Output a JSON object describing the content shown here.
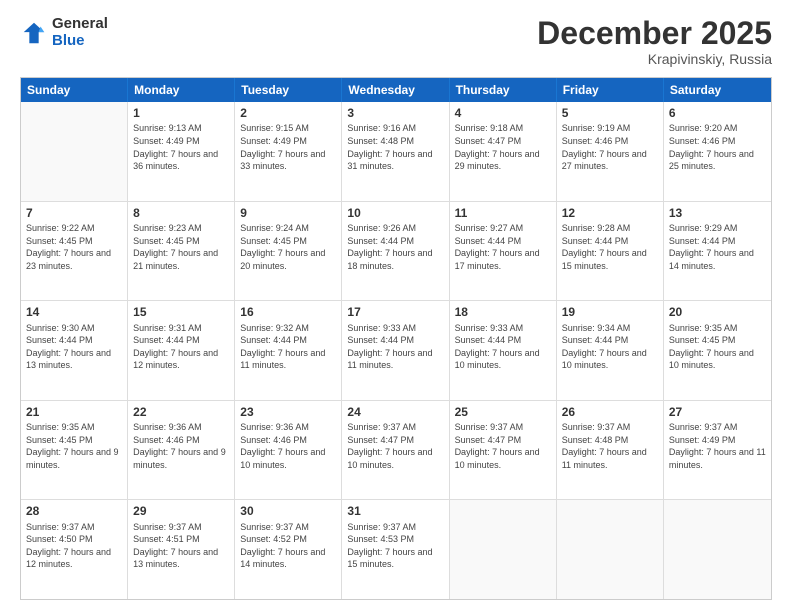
{
  "header": {
    "logo_general": "General",
    "logo_blue": "Blue",
    "month_title": "December 2025",
    "subtitle": "Krapivinskiy, Russia"
  },
  "calendar": {
    "days_of_week": [
      "Sunday",
      "Monday",
      "Tuesday",
      "Wednesday",
      "Thursday",
      "Friday",
      "Saturday"
    ],
    "rows": [
      [
        {
          "day": "",
          "info": ""
        },
        {
          "day": "1",
          "info": "Sunrise: 9:13 AM\nSunset: 4:49 PM\nDaylight: 7 hours\nand 36 minutes."
        },
        {
          "day": "2",
          "info": "Sunrise: 9:15 AM\nSunset: 4:49 PM\nDaylight: 7 hours\nand 33 minutes."
        },
        {
          "day": "3",
          "info": "Sunrise: 9:16 AM\nSunset: 4:48 PM\nDaylight: 7 hours\nand 31 minutes."
        },
        {
          "day": "4",
          "info": "Sunrise: 9:18 AM\nSunset: 4:47 PM\nDaylight: 7 hours\nand 29 minutes."
        },
        {
          "day": "5",
          "info": "Sunrise: 9:19 AM\nSunset: 4:46 PM\nDaylight: 7 hours\nand 27 minutes."
        },
        {
          "day": "6",
          "info": "Sunrise: 9:20 AM\nSunset: 4:46 PM\nDaylight: 7 hours\nand 25 minutes."
        }
      ],
      [
        {
          "day": "7",
          "info": "Sunrise: 9:22 AM\nSunset: 4:45 PM\nDaylight: 7 hours\nand 23 minutes."
        },
        {
          "day": "8",
          "info": "Sunrise: 9:23 AM\nSunset: 4:45 PM\nDaylight: 7 hours\nand 21 minutes."
        },
        {
          "day": "9",
          "info": "Sunrise: 9:24 AM\nSunset: 4:45 PM\nDaylight: 7 hours\nand 20 minutes."
        },
        {
          "day": "10",
          "info": "Sunrise: 9:26 AM\nSunset: 4:44 PM\nDaylight: 7 hours\nand 18 minutes."
        },
        {
          "day": "11",
          "info": "Sunrise: 9:27 AM\nSunset: 4:44 PM\nDaylight: 7 hours\nand 17 minutes."
        },
        {
          "day": "12",
          "info": "Sunrise: 9:28 AM\nSunset: 4:44 PM\nDaylight: 7 hours\nand 15 minutes."
        },
        {
          "day": "13",
          "info": "Sunrise: 9:29 AM\nSunset: 4:44 PM\nDaylight: 7 hours\nand 14 minutes."
        }
      ],
      [
        {
          "day": "14",
          "info": "Sunrise: 9:30 AM\nSunset: 4:44 PM\nDaylight: 7 hours\nand 13 minutes."
        },
        {
          "day": "15",
          "info": "Sunrise: 9:31 AM\nSunset: 4:44 PM\nDaylight: 7 hours\nand 12 minutes."
        },
        {
          "day": "16",
          "info": "Sunrise: 9:32 AM\nSunset: 4:44 PM\nDaylight: 7 hours\nand 11 minutes."
        },
        {
          "day": "17",
          "info": "Sunrise: 9:33 AM\nSunset: 4:44 PM\nDaylight: 7 hours\nand 11 minutes."
        },
        {
          "day": "18",
          "info": "Sunrise: 9:33 AM\nSunset: 4:44 PM\nDaylight: 7 hours\nand 10 minutes."
        },
        {
          "day": "19",
          "info": "Sunrise: 9:34 AM\nSunset: 4:44 PM\nDaylight: 7 hours\nand 10 minutes."
        },
        {
          "day": "20",
          "info": "Sunrise: 9:35 AM\nSunset: 4:45 PM\nDaylight: 7 hours\nand 10 minutes."
        }
      ],
      [
        {
          "day": "21",
          "info": "Sunrise: 9:35 AM\nSunset: 4:45 PM\nDaylight: 7 hours\nand 9 minutes."
        },
        {
          "day": "22",
          "info": "Sunrise: 9:36 AM\nSunset: 4:46 PM\nDaylight: 7 hours\nand 9 minutes."
        },
        {
          "day": "23",
          "info": "Sunrise: 9:36 AM\nSunset: 4:46 PM\nDaylight: 7 hours\nand 10 minutes."
        },
        {
          "day": "24",
          "info": "Sunrise: 9:37 AM\nSunset: 4:47 PM\nDaylight: 7 hours\nand 10 minutes."
        },
        {
          "day": "25",
          "info": "Sunrise: 9:37 AM\nSunset: 4:47 PM\nDaylight: 7 hours\nand 10 minutes."
        },
        {
          "day": "26",
          "info": "Sunrise: 9:37 AM\nSunset: 4:48 PM\nDaylight: 7 hours\nand 11 minutes."
        },
        {
          "day": "27",
          "info": "Sunrise: 9:37 AM\nSunset: 4:49 PM\nDaylight: 7 hours\nand 11 minutes."
        }
      ],
      [
        {
          "day": "28",
          "info": "Sunrise: 9:37 AM\nSunset: 4:50 PM\nDaylight: 7 hours\nand 12 minutes."
        },
        {
          "day": "29",
          "info": "Sunrise: 9:37 AM\nSunset: 4:51 PM\nDaylight: 7 hours\nand 13 minutes."
        },
        {
          "day": "30",
          "info": "Sunrise: 9:37 AM\nSunset: 4:52 PM\nDaylight: 7 hours\nand 14 minutes."
        },
        {
          "day": "31",
          "info": "Sunrise: 9:37 AM\nSunset: 4:53 PM\nDaylight: 7 hours\nand 15 minutes."
        },
        {
          "day": "",
          "info": ""
        },
        {
          "day": "",
          "info": ""
        },
        {
          "day": "",
          "info": ""
        }
      ]
    ]
  }
}
